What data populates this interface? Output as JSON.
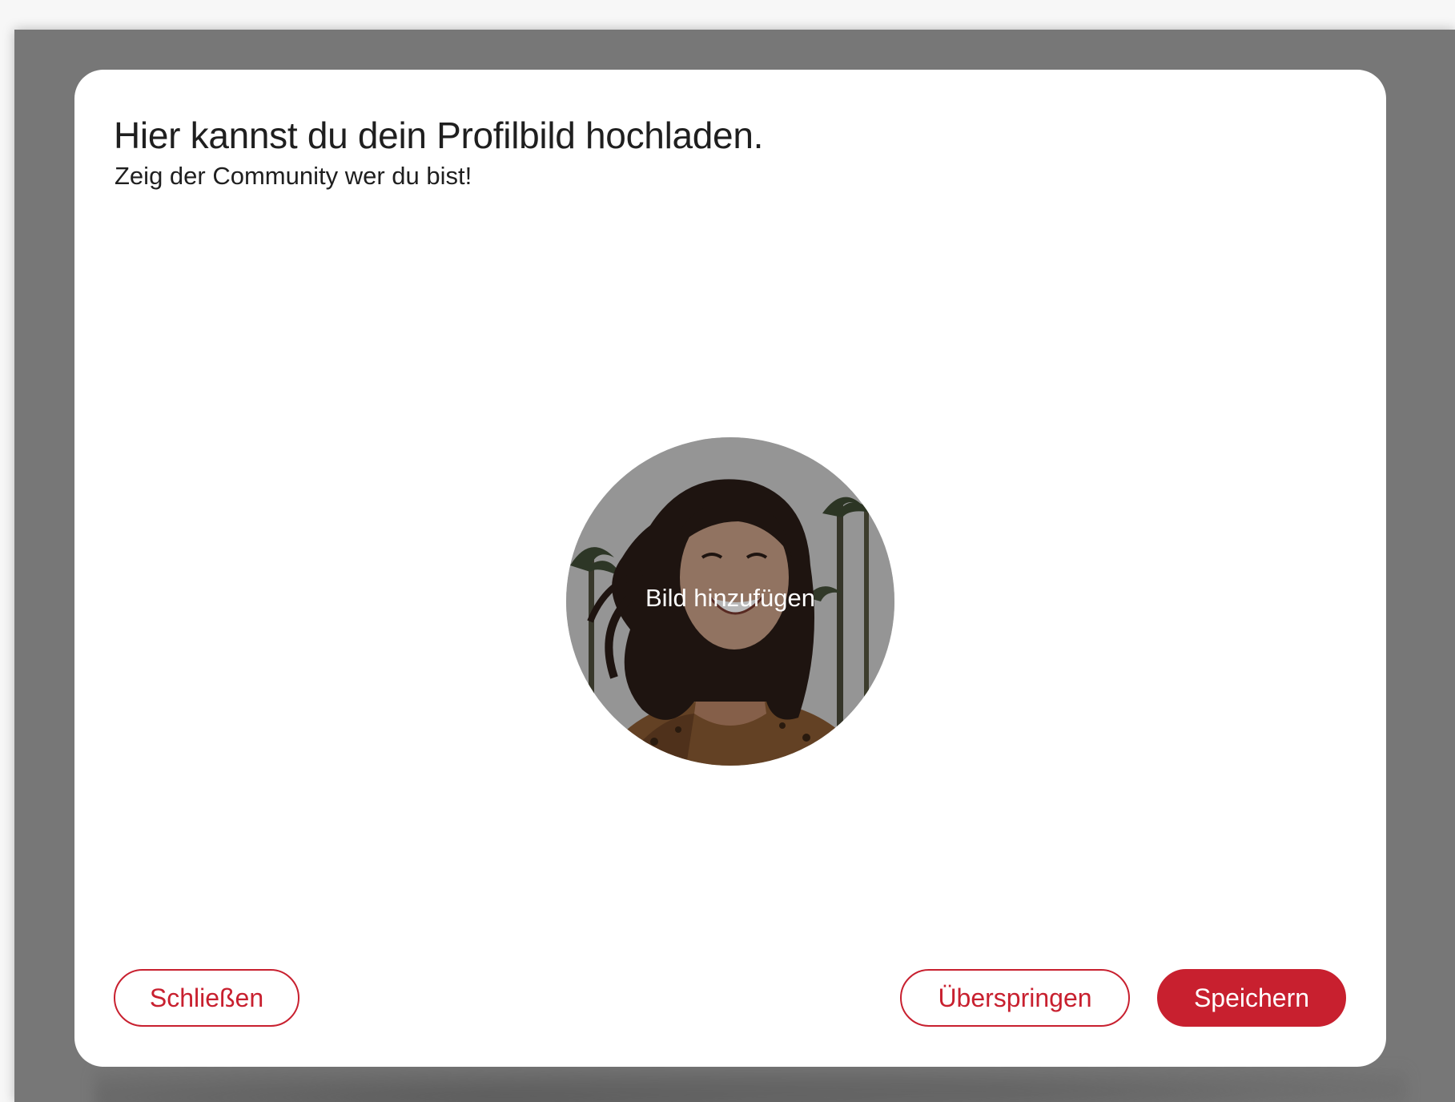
{
  "modal": {
    "title": "Hier kannst du dein Profilbild hochladen.",
    "subtitle": "Zeig der Community wer du bist!",
    "avatar": {
      "label": "Bild hinzufügen",
      "image_subject": "smiling-woman-photo"
    },
    "buttons": {
      "close_label": "Schließen",
      "skip_label": "Überspringen",
      "save_label": "Speichern"
    }
  },
  "colors": {
    "accent": "#c8202f",
    "backdrop": "#777777",
    "modal_background": "#ffffff",
    "text": "#1f1f1f"
  }
}
